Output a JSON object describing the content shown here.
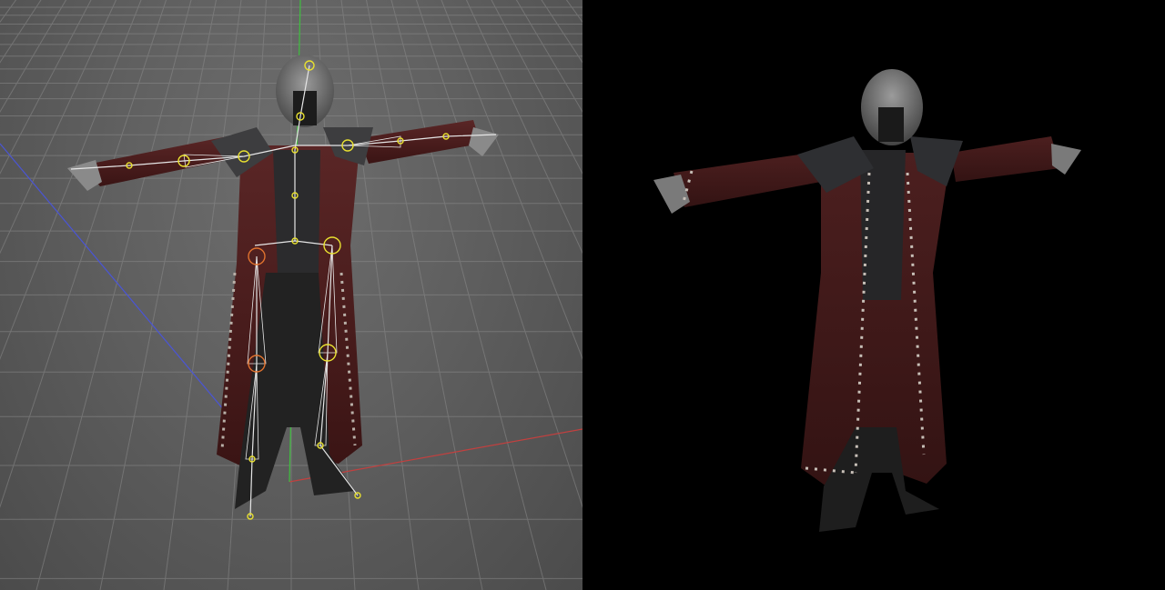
{
  "viewport": {
    "grid_color": "#8b8b8b",
    "axis_x_color": "#c2403f",
    "axis_y_color": "#3fbf3f",
    "axis_z_color": "#4a55d6",
    "joint_color": "#e8e030",
    "bone_color": "#e6e6e6",
    "selected_joint_color": "#e0722e"
  },
  "render": {
    "background": "#000000",
    "coat_color": "#4c1f1f",
    "armor_color": "#7b7b7b"
  }
}
